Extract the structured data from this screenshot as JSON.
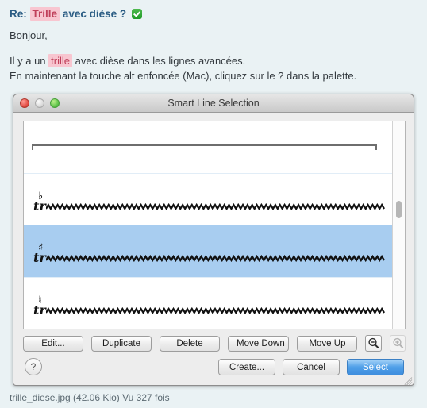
{
  "post": {
    "title_prefix": "Re:",
    "title_highlight": "Trille",
    "title_suffix": "avec dièse ?",
    "verified_icon": "check-badge-icon",
    "greeting": "Bonjour,",
    "body_line_1_before": "Il y a un",
    "body_line_1_highlight": "trille",
    "body_line_1_after": "avec dièse dans les lignes avancées.",
    "body_line_2": "En maintenant la touche alt enfoncée (Mac), cliquez sur le ? dans la palette.",
    "highlight_bg": "#f8c6d0",
    "highlight_fg": "#c0405a",
    "title_color": "#2b5d84"
  },
  "dialog": {
    "title": "Smart Line Selection",
    "traffic_lights": [
      {
        "name": "close",
        "color": "#e24c43"
      },
      {
        "name": "minimize",
        "color": "#d8d8d8"
      },
      {
        "name": "zoom",
        "color": "#5ec34a"
      }
    ],
    "selection_color": "#a8cdf0",
    "rows": [
      {
        "type": "bracket",
        "glyph": "",
        "accidental": "",
        "selected": false
      },
      {
        "type": "trill",
        "glyph": "tr",
        "accidental": "♭",
        "selected": false
      },
      {
        "type": "trill",
        "glyph": "tr",
        "accidental": "♯",
        "selected": true
      },
      {
        "type": "trill",
        "glyph": "tr",
        "accidental": "♮",
        "selected": false
      }
    ],
    "buttons": {
      "edit": "Edit...",
      "duplicate": "Duplicate",
      "delete": "Delete",
      "move_down": "Move Down",
      "move_up": "Move Up",
      "create": "Create...",
      "cancel": "Cancel",
      "select": "Select",
      "help": "?"
    },
    "zoom_controls": {
      "zoom_out": "zoom-out-icon",
      "zoom_in": "zoom-in-icon",
      "zoom_in_disabled": true
    },
    "resize_grip": "resize-grip-icon"
  },
  "attachment": {
    "caption": "trille_diese.jpg (42.06 Kio) Vu 327 fois"
  }
}
